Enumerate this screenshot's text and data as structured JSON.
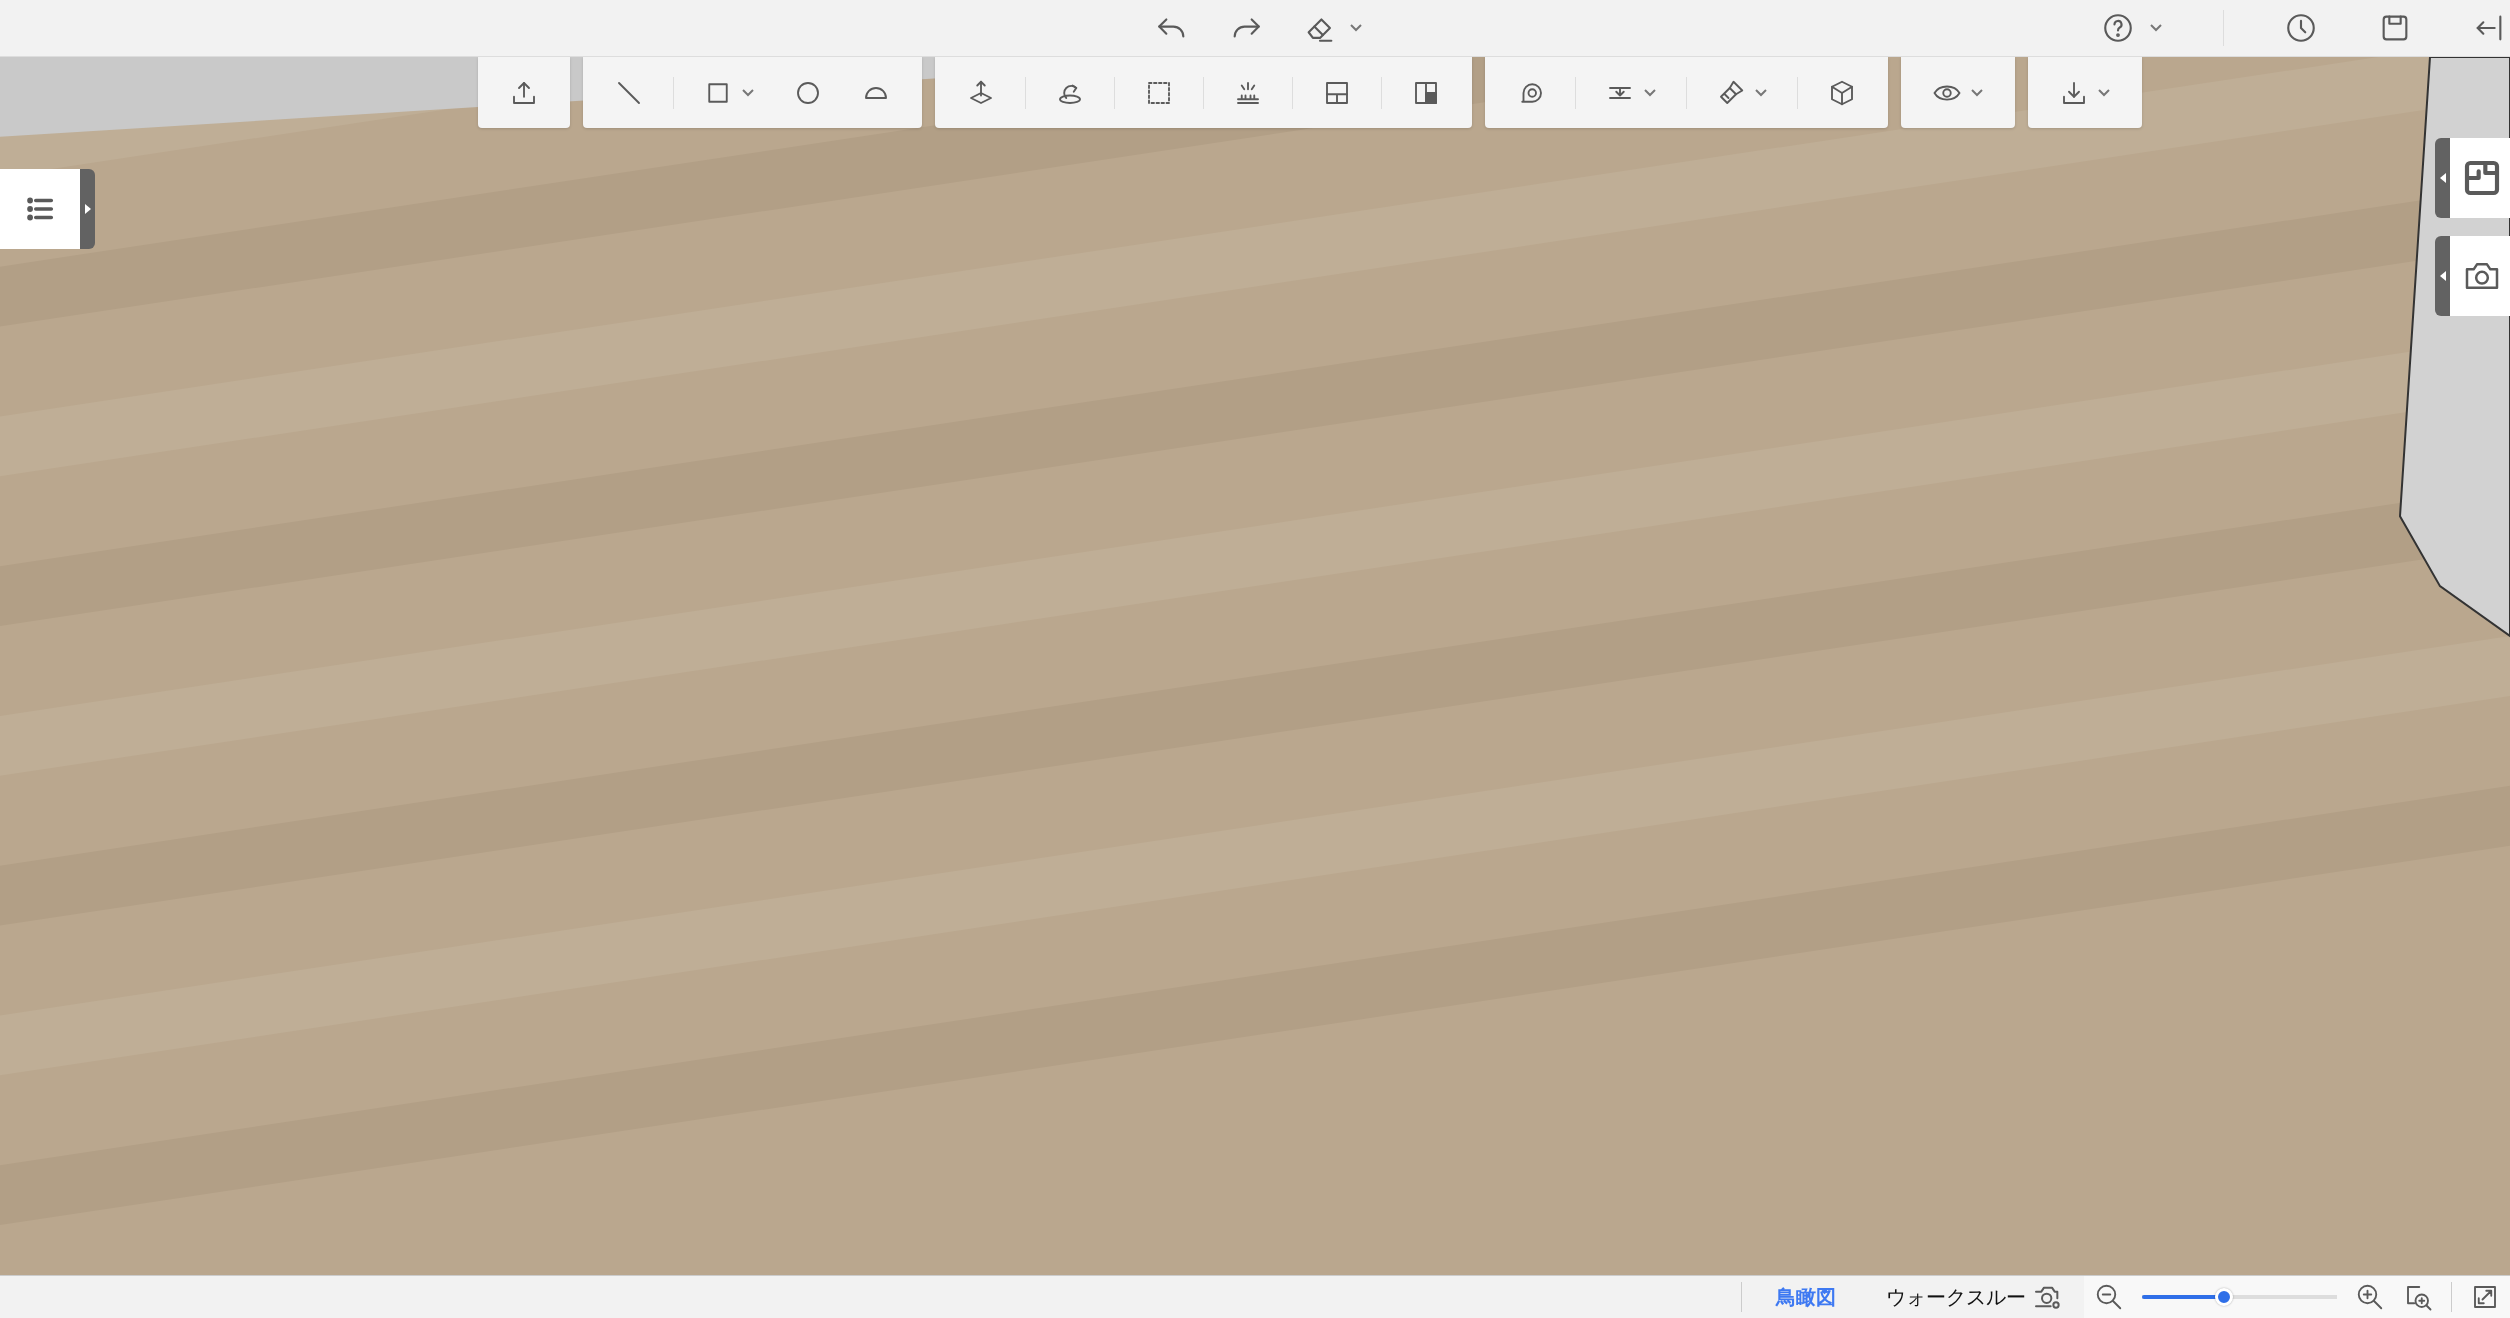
{
  "view_modes": [
    {
      "label": "鳥瞰図",
      "selected": true
    },
    {
      "label": "ウォークスルー",
      "selected": false
    }
  ],
  "zoom": {
    "level": 0.42
  }
}
